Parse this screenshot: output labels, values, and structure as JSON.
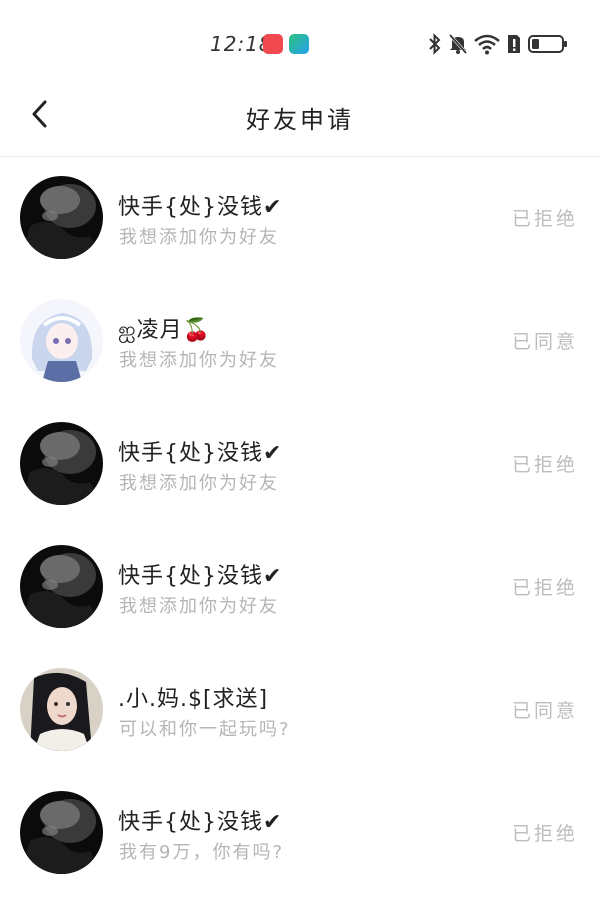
{
  "status_bar": {
    "time": "12:18",
    "icons": [
      "bluetooth-icon",
      "mute-icon",
      "wifi-icon",
      "alert-sim-icon",
      "battery-icon"
    ]
  },
  "header": {
    "title": "好友申请",
    "back_icon": "chevron-left-icon"
  },
  "requests": [
    {
      "name": "快手{处}没钱✔",
      "message": "我想添加你为好友",
      "status": "已拒绝",
      "avatar": "dark-portrait"
    },
    {
      "name": "ஐ凌月🍒",
      "message": "我想添加你为好友",
      "status": "已同意",
      "avatar": "anime-girl"
    },
    {
      "name": "快手{处}没钱✔",
      "message": "我想添加你为好友",
      "status": "已拒绝",
      "avatar": "dark-portrait"
    },
    {
      "name": "快手{处}没钱✔",
      "message": "我想添加你为好友",
      "status": "已拒绝",
      "avatar": "dark-portrait"
    },
    {
      "name": ".小.妈.$[求送]",
      "message": "可以和你一起玩吗?",
      "status": "已同意",
      "avatar": "girl-photo"
    },
    {
      "name": "快手{处}没钱✔",
      "message": "我有9万，你有吗?",
      "status": "已拒绝",
      "avatar": "dark-portrait"
    }
  ],
  "colors": {
    "background": "#ffffff",
    "primary_text": "#222222",
    "secondary_text": "#b5b5b5",
    "status_text": "#bdbdbd"
  }
}
